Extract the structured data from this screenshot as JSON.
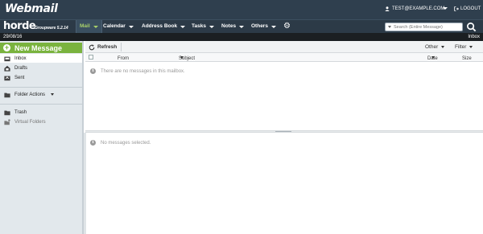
{
  "topbar": {
    "logo": "Webmail",
    "user_label": "TEST@EXAMPLE.COM",
    "logout_label": "LOGOUT"
  },
  "menubar": {
    "brand": "horde",
    "version": "Groupware 5.2.14",
    "items": [
      {
        "label": "Mail",
        "active": true
      },
      {
        "label": "Calendar"
      },
      {
        "label": "Address Book"
      },
      {
        "label": "Tasks"
      },
      {
        "label": "Notes"
      },
      {
        "label": "Others"
      }
    ],
    "search_placeholder": "Search (Entire Message)"
  },
  "datebar": {
    "date": "29/08/16",
    "current_folder": "Inbox"
  },
  "sidebar": {
    "new_message_label": "New Message",
    "folders": [
      {
        "label": "Inbox",
        "icon": "inbox-icon",
        "selected": true
      },
      {
        "label": "Drafts",
        "icon": "drafts-icon"
      },
      {
        "label": "Sent",
        "icon": "sent-icon"
      }
    ],
    "folder_actions_label": "Folder Actions",
    "extra": [
      {
        "label": "Trash",
        "icon": "trash-icon"
      },
      {
        "label": "Virtual Folders",
        "icon": "virtual-folders-icon"
      }
    ]
  },
  "toolbar": {
    "refresh_label": "Refresh",
    "other_label": "Other",
    "filter_label": "Filter"
  },
  "columns": {
    "from": "From",
    "subject": "Subject",
    "date": "Date",
    "size": "Size"
  },
  "messages": {
    "empty_text": "There are no messages in this mailbox.",
    "preview_text": "No messages selected."
  },
  "colors": {
    "accent": "#7ab33e",
    "header_bg": "#2f3f4e",
    "active_menu_text": "#a8d06a"
  }
}
